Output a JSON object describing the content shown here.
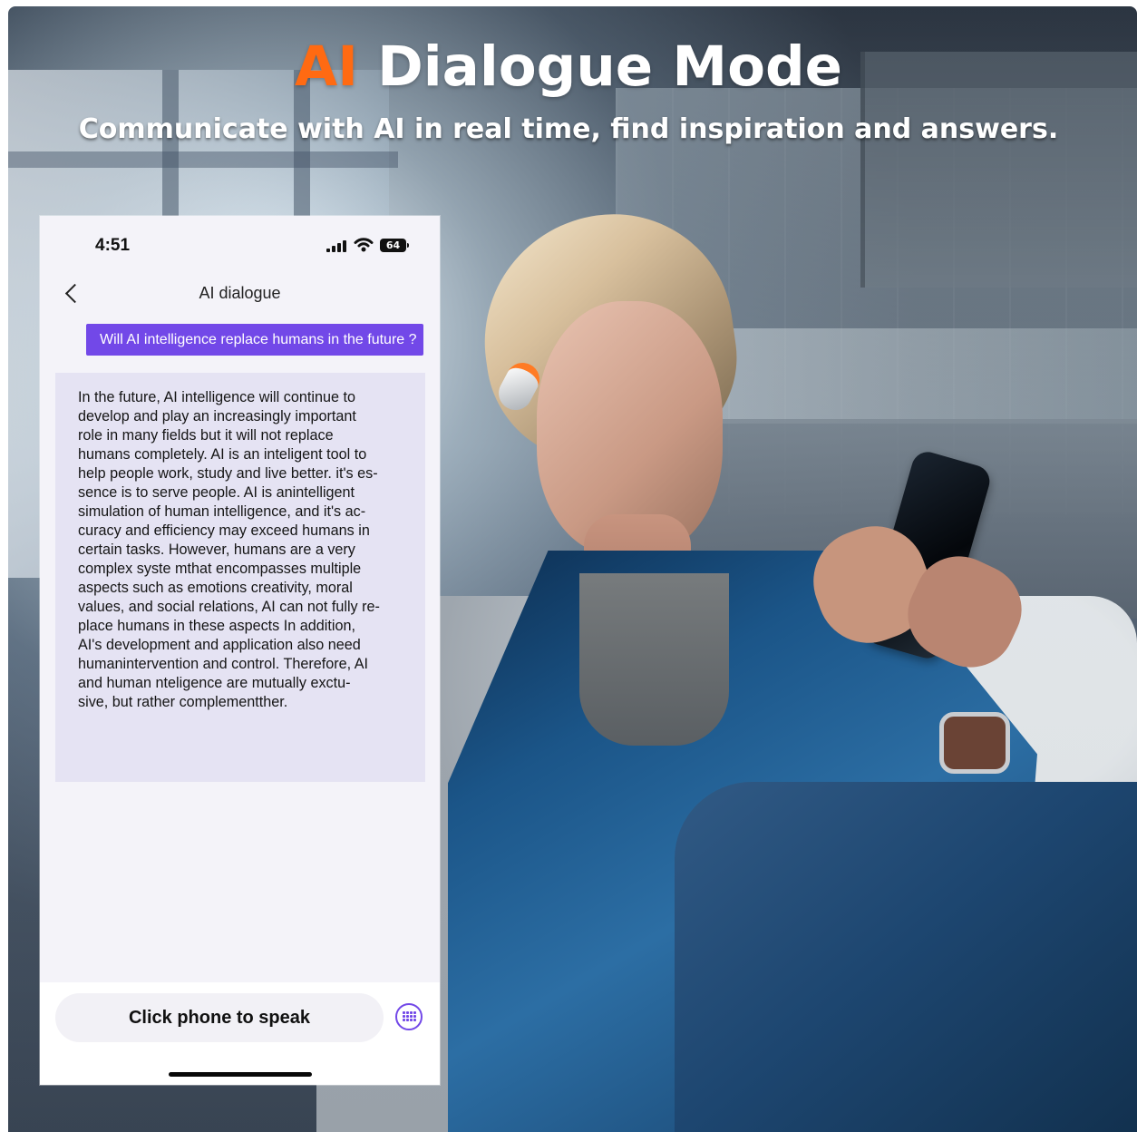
{
  "hero": {
    "title_accent": "AI",
    "title_rest": "Dialogue Mode",
    "subtitle": "Communicate with AI in real time, find inspiration and answers."
  },
  "phone": {
    "status_bar": {
      "time": "4:51",
      "battery": "64"
    },
    "navigation": {
      "back_icon": "chevron-left-icon",
      "title": "AI dialogue"
    },
    "user_message": "Will AI intelligence replace humans in the future ?",
    "ai_response": "In the future, AI intelligence will continue to\ndevelop and play an increasingly important\nrole in many fields but it will not replace\nhumans completely. AI is an inteligent tool to\nhelp people work, study and live better. it's es-\nsence is to serve people. AI is anintelligent\nsimulation of human intelligence, and it's ac-\ncuracy and efficiency may exceed humans in\ncertain tasks. However, humans are a very\ncomplex syste mthat encompasses multiple\naspects such as emotions creativity, moral\nvalues, and social relations, AI can not fully re-\nplace humans in these aspects In addition,\nAI's development and application also need\nhumanintervention and control. Therefore, AI\nand human nteligence are mutually exctu-\nsive, but rather complementther.",
    "speak_button": "Click phone to speak",
    "keyboard_icon": "keyboard-icon"
  },
  "colors": {
    "accent_orange": "#ff6a12",
    "purple": "#7248e8",
    "response_background": "#e5e3f3"
  }
}
